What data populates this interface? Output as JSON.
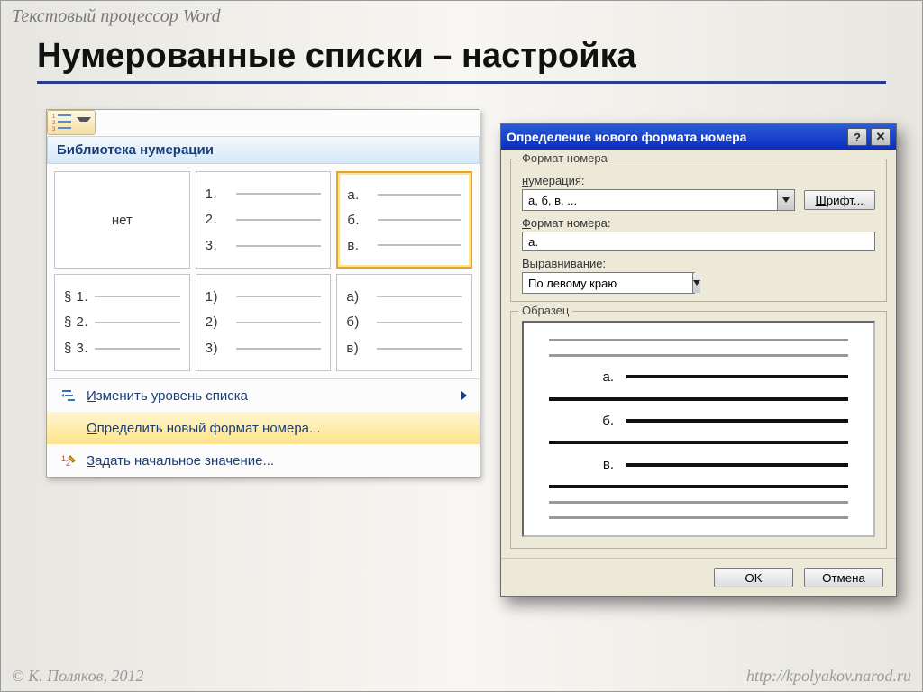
{
  "header": "Текстовый процессор Word",
  "title": "Нумерованные списки – настройка",
  "footer": {
    "left": "© К. Поляков, 2012",
    "right": "http://kpolyakov.narod.ru"
  },
  "gallery": {
    "header": "Библиотека нумерации",
    "tiles": [
      {
        "none": true,
        "label": "нет"
      },
      {
        "markers": [
          "1.",
          "2.",
          "3."
        ]
      },
      {
        "markers": [
          "а.",
          "б.",
          "в."
        ],
        "selected": true
      },
      {
        "markers": [
          "§ 1.",
          "§ 2.",
          "§ 3."
        ]
      },
      {
        "markers": [
          "1)",
          "2)",
          "3)"
        ]
      },
      {
        "markers": [
          "а)",
          "б)",
          "в)"
        ]
      }
    ],
    "menu": {
      "level": "Изменить уровень списка",
      "define": "Определить новый формат номера...",
      "start": "Задать начальное значение..."
    }
  },
  "dialog": {
    "title": "Определение нового формата номера",
    "group_format": "Формат номера",
    "lbl_numbering": "нумерация:",
    "numbering_value": "а, б, в, ...",
    "font_btn": "Шрифт...",
    "lbl_format": "Формат номера:",
    "format_value": "а.",
    "lbl_align": "Выравнивание:",
    "align_value": "По левому краю",
    "group_preview": "Образец",
    "preview_markers": [
      "а.",
      "б.",
      "в."
    ],
    "ok": "OK",
    "cancel": "Отмена"
  }
}
